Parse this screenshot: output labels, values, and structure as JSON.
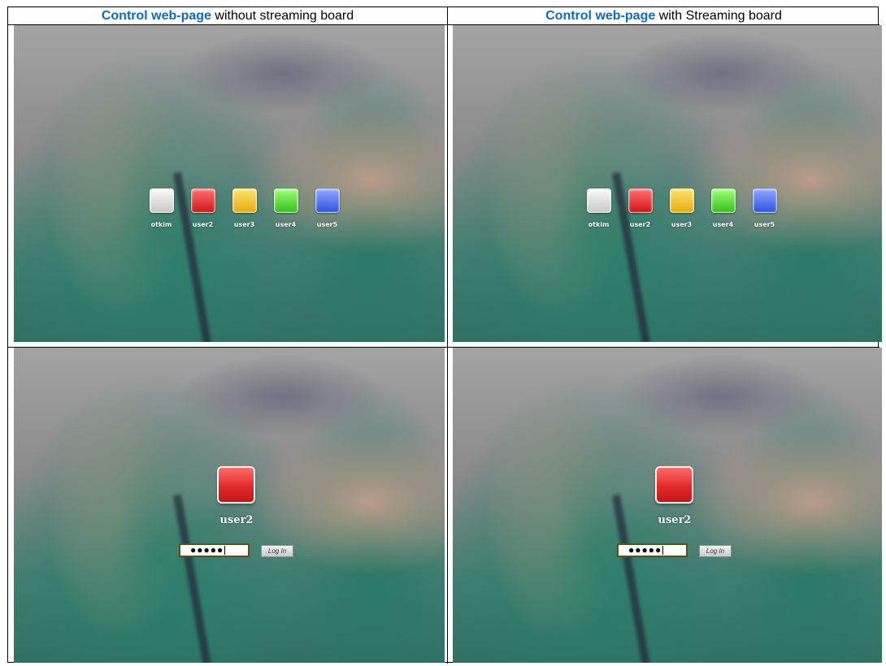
{
  "header_left": {
    "highlight": "Control web-page",
    "rest": " without streaming board"
  },
  "header_right": {
    "highlight": "Control web-page",
    "rest": " with Streaming board"
  },
  "users": [
    {
      "name": "otkim",
      "color_top": "#fafafa",
      "color_bottom": "#c9c9c9"
    },
    {
      "name": "user2",
      "color_top": "#ff7070",
      "color_bottom": "#d01818"
    },
    {
      "name": "user3",
      "color_top": "#ffe36b",
      "color_bottom": "#e5ad10"
    },
    {
      "name": "user4",
      "color_top": "#9dff7a",
      "color_bottom": "#36c21a"
    },
    {
      "name": "user5",
      "color_top": "#8fa6ff",
      "color_bottom": "#2f55e0"
    }
  ],
  "login": {
    "user": "user2",
    "password_mask": "●●●●●",
    "button_label": "Log In"
  }
}
